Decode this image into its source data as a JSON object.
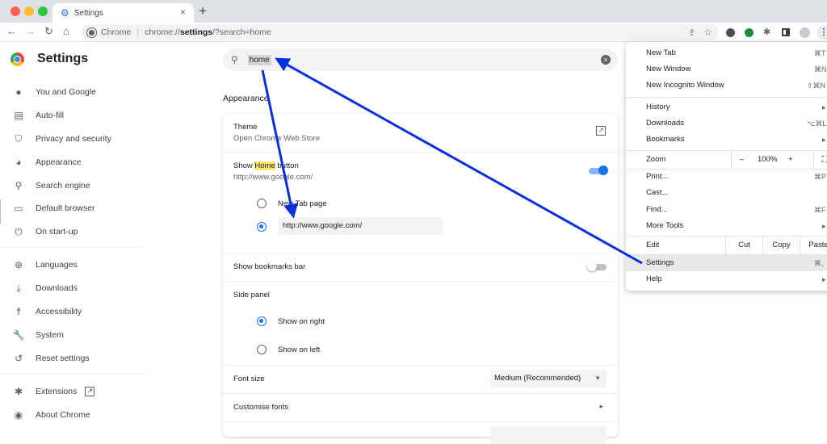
{
  "window": {
    "traffic_colors": [
      "#ff5f57",
      "#febc2e",
      "#28c840"
    ]
  },
  "tab": {
    "title": "Settings",
    "close": "×",
    "new_tab": "+"
  },
  "toolbar": {
    "back": "←",
    "forward": "→",
    "reload": "↻",
    "home": "⌂",
    "site_label": "Chrome",
    "url_prefix": "chrome://",
    "url_bold": "settings",
    "url_suffix": "/?search=home",
    "icons": [
      "share-icon",
      "bookmark-star-icon",
      "extension-1-icon",
      "extension-2-icon",
      "extensions-puzzle-icon",
      "side-panel-icon",
      "profile-icon",
      "menu-kebab-icon"
    ]
  },
  "sidebar": {
    "title": "Settings",
    "items": [
      {
        "label": "You and Google",
        "icon": "👤"
      },
      {
        "label": "Auto-fill",
        "icon": "📋"
      },
      {
        "label": "Privacy and security",
        "icon": "🛡"
      },
      {
        "label": "Appearance",
        "icon": "🎨"
      },
      {
        "label": "Search engine",
        "icon": "🔍"
      },
      {
        "label": "Default browser",
        "icon": "▭"
      },
      {
        "label": "On start-up",
        "icon": "⏻"
      },
      {
        "label": "Languages",
        "icon": "🌐"
      },
      {
        "label": "Downloads",
        "icon": "⤓"
      },
      {
        "label": "Accessibility",
        "icon": "♿"
      },
      {
        "label": "System",
        "icon": "🔧"
      },
      {
        "label": "Reset settings",
        "icon": "↺"
      },
      {
        "label": "Extensions",
        "icon": "🧩",
        "external": "↗"
      },
      {
        "label": "About Chrome",
        "icon": "◉"
      }
    ]
  },
  "search": {
    "query": "home",
    "search_icon": "🔍",
    "clear_icon": "×"
  },
  "main": {
    "section_title": "Appearance",
    "theme": {
      "label": "Theme",
      "sub": "Open Chrome Web Store",
      "icon": "↗"
    },
    "home_button": {
      "label_pre": "Show ",
      "label_hl": "Home",
      "label_post": " button",
      "sub": "http://www.google.com/",
      "enabled": true,
      "options": [
        {
          "label": "New Tab page",
          "selected": false
        },
        {
          "label": "http://www.google.com/",
          "selected": true
        }
      ]
    },
    "bookmarks_bar": {
      "label": "Show bookmarks bar",
      "enabled": false
    },
    "side_panel": {
      "label": "Side panel",
      "options": [
        {
          "label": "Show on right",
          "selected": true
        },
        {
          "label": "Show on left",
          "selected": false
        }
      ]
    },
    "font_size": {
      "label": "Font size",
      "value": "Medium (Recommended)",
      "caret": "▼"
    },
    "customise_fonts": {
      "label": "Customise fonts",
      "chevron": "▸"
    }
  },
  "menu": {
    "items_top": [
      {
        "label": "New Tab",
        "shortcut": "⌘T"
      },
      {
        "label": "New Window",
        "shortcut": "⌘N"
      },
      {
        "label": "New Incognito Window",
        "shortcut": "⇧⌘N"
      }
    ],
    "items_mid": [
      {
        "label": "History",
        "shortcut": "▸"
      },
      {
        "label": "Downloads",
        "shortcut": "⌥⌘L"
      },
      {
        "label": "Bookmarks",
        "shortcut": "▸"
      }
    ],
    "zoom": {
      "label": "Zoom",
      "minus": "–",
      "value": "100%",
      "plus": "+",
      "fullscreen": "⛶"
    },
    "items_tools": [
      {
        "label": "Print...",
        "shortcut": "⌘P"
      },
      {
        "label": "Cast...",
        "shortcut": ""
      },
      {
        "label": "Find...",
        "shortcut": "⌘F"
      },
      {
        "label": "More Tools",
        "shortcut": "▸"
      }
    ],
    "edit": {
      "label": "Edit",
      "cut": "Cut",
      "copy": "Copy",
      "paste": "Paste"
    },
    "items_bottom": [
      {
        "label": "Settings",
        "shortcut": "⌘,",
        "highlighted": true
      },
      {
        "label": "Help",
        "shortcut": "▸"
      }
    ]
  },
  "annotation": {
    "arrow_color": "#0a2fe0"
  }
}
